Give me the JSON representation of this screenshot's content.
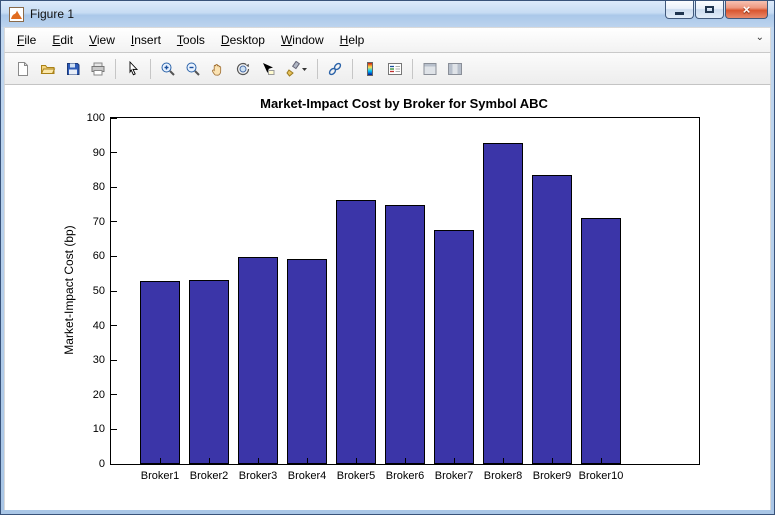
{
  "window": {
    "title": "Figure 1"
  },
  "titlebar": {
    "buttons": [
      "minimize",
      "maximize",
      "close"
    ],
    "close_glyph": "×"
  },
  "menubar": {
    "items": [
      "File",
      "Edit",
      "View",
      "Insert",
      "Tools",
      "Desktop",
      "Window",
      "Help"
    ],
    "overflow_glyph": "⌄"
  },
  "toolbar": {
    "buttons": [
      "new-figure",
      "open-file",
      "save-figure",
      "print-figure",
      "edit-plot",
      "zoom-in",
      "zoom-out",
      "pan",
      "rotate-3d",
      "data-cursor",
      "brush",
      "link-plot",
      "insert-colorbar",
      "insert-legend",
      "hide-plot-tools",
      "show-plot-tools"
    ]
  },
  "chart_data": {
    "type": "bar",
    "title": "Market-Impact Cost by Broker for Symbol ABC",
    "xlabel": "",
    "ylabel": "Market-Impact Cost (bp)",
    "categories": [
      "Broker1",
      "Broker2",
      "Broker3",
      "Broker4",
      "Broker5",
      "Broker6",
      "Broker7",
      "Broker8",
      "Broker9",
      "Broker10"
    ],
    "values": [
      52.8,
      53.2,
      59.7,
      59.2,
      76.2,
      74.8,
      67.6,
      92.8,
      83.5,
      71.0
    ],
    "ylim": [
      0,
      100
    ],
    "yticks": [
      0,
      10,
      20,
      30,
      40,
      50,
      60,
      70,
      80,
      90,
      100
    ],
    "grid": false,
    "bar_color": "#3b35a8",
    "bar_edge_color": "#000000",
    "legend": "none"
  }
}
